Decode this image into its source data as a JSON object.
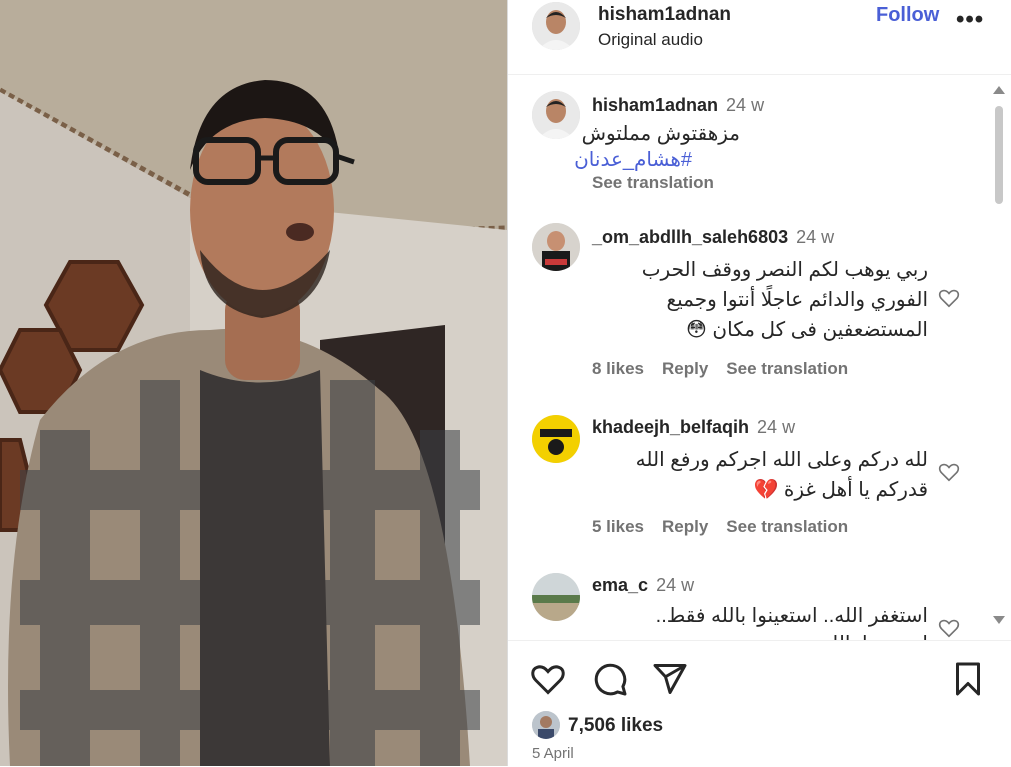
{
  "post": {
    "username": "hisham1adnan",
    "audio": "Original audio",
    "follow_label": "Follow",
    "more_label": "•••"
  },
  "caption": {
    "username": "hisham1adnan",
    "time": "24 w",
    "text": "مزهقتوش مملتوش",
    "hashtag": "#هشام_عدنان",
    "see_translation": "See translation"
  },
  "comments": [
    {
      "username": "_om_abdllh_saleh6803",
      "time": "24 w",
      "lines": [
        "ربي يوهب لكم النصر ووقف الحرب",
        "الفوري والدائم عاجلًا أنتوا وجميع",
        "المستضعفين فى كل مكان 😳"
      ],
      "likes": "8 likes",
      "reply": "Reply",
      "see_translation": "See translation"
    },
    {
      "username": "khadeejh_belfaqih",
      "time": "24 w",
      "lines": [
        "لله دركم وعلى الله اجركم ورفع الله",
        "قدركم يا أهل غزة 💔"
      ],
      "likes": "5 likes",
      "reply": "Reply",
      "see_translation": "See translation"
    },
    {
      "username": "ema_c",
      "time": "24 w",
      "lines": [
        "استغفر الله.. استعينوا بالله فقط..",
        "استعينوا بالله"
      ],
      "likes": "",
      "reply": "",
      "see_translation": ""
    }
  ],
  "footer": {
    "likes": "7,506 likes",
    "date": "5 April"
  },
  "colors": {
    "accent": "#4a5fd6",
    "text": "#262626",
    "muted": "#737373"
  },
  "icons": [
    "heart-icon",
    "comment-icon",
    "share-icon",
    "bookmark-icon",
    "more-icon"
  ]
}
